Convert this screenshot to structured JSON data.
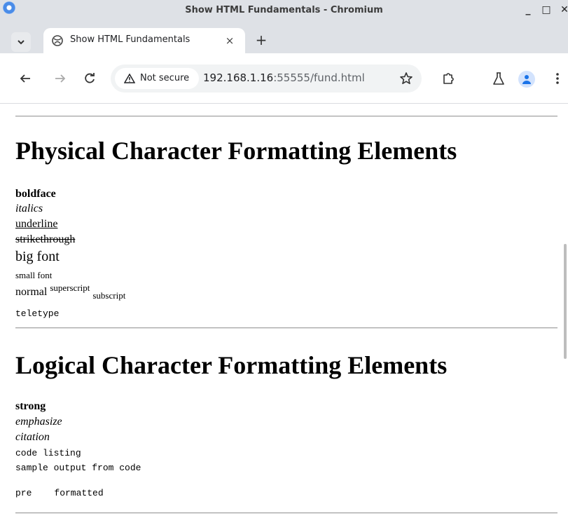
{
  "window": {
    "title": "Show HTML Fundamentals - Chromium",
    "minimize": "_",
    "maximize": "□",
    "close": "✕"
  },
  "tab": {
    "title": "Show HTML Fundamentals",
    "close": "×",
    "new_tab": "+"
  },
  "toolbar": {
    "security_label": "Not secure",
    "url_host": "192.168.1.16",
    "url_rest": ":55555/fund.html"
  },
  "icons": {
    "tab_list": "chevron-down-icon",
    "favicon": "globe-icon",
    "back": "arrow-left-icon",
    "forward": "arrow-right-icon",
    "reload": "reload-icon",
    "security": "warning-triangle-icon",
    "bookmark": "star-icon",
    "extensions": "puzzle-icon",
    "labs": "flask-icon",
    "profile": "person-icon",
    "menu": "kebab-menu-icon"
  },
  "physical": {
    "heading": "Physical Character Formatting Elements",
    "boldface": "boldface",
    "italics": "italics",
    "underline": "underline",
    "strikethrough": "strikethrough",
    "big_font": "big font",
    "small_font": "small font",
    "normal": "normal",
    "superscript": "superscript",
    "subscript": "subscript",
    "teletype": "teletype"
  },
  "logical": {
    "heading": "Logical Character Formatting Elements",
    "strong": "strong",
    "emphasize": "emphasize",
    "citation": "citation",
    "code": "code listing",
    "sample": "sample output from code",
    "pre_word1": "pre",
    "pre_word2": "formatted"
  }
}
